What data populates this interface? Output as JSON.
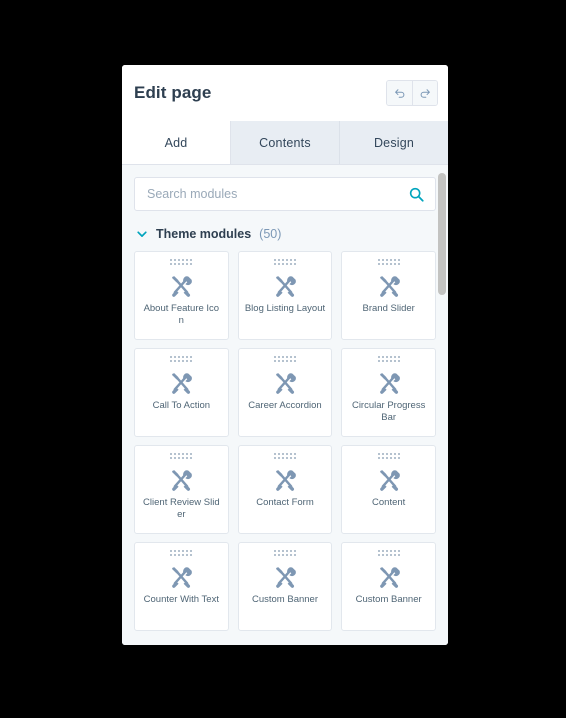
{
  "panel": {
    "title": "Edit page",
    "history": {
      "undo_label": "Undo",
      "undo_icon": "undo-arrow-icon",
      "redo_label": "Redo",
      "redo_icon": "redo-arrow-icon"
    },
    "tabs": [
      {
        "label": "Add",
        "active": true
      },
      {
        "label": "Contents",
        "active": false
      },
      {
        "label": "Design",
        "active": false
      }
    ]
  },
  "search": {
    "value": "",
    "placeholder": "Search modules",
    "icon": "search-icon",
    "icon_color": "#00a4bd"
  },
  "section": {
    "chevron_icon": "chevron-down-icon",
    "chevron_color": "#00a4bd",
    "title": "Theme modules",
    "count": "(50)",
    "expanded": true
  },
  "modules": [
    {
      "label": "About Feature Icon",
      "icon": "tools-icon"
    },
    {
      "label": "Blog Listing Layout",
      "icon": "tools-icon"
    },
    {
      "label": "Brand Slider",
      "icon": "tools-icon"
    },
    {
      "label": "Call To Action",
      "icon": "tools-icon"
    },
    {
      "label": "Career Accordion",
      "icon": "tools-icon"
    },
    {
      "label": "Circular Progress Bar",
      "icon": "tools-icon"
    },
    {
      "label": "Client Review Slider",
      "icon": "tools-icon"
    },
    {
      "label": "Contact Form",
      "icon": "tools-icon"
    },
    {
      "label": "Content",
      "icon": "tools-icon"
    },
    {
      "label": "Counter With Text",
      "icon": "tools-icon"
    },
    {
      "label": "Custom Banner",
      "icon": "tools-icon"
    },
    {
      "label": "Custom Banner",
      "icon": "tools-icon"
    }
  ],
  "colors": {
    "accent": "#00a4bd",
    "title_text": "#2e3f50",
    "body_text": "#33475b",
    "module_icon": "#7e97b3",
    "panel_bg": "#f5f8fa",
    "card_bg": "#ffffff",
    "backdrop": "#000000"
  },
  "scrollbar": {
    "thumb_color": "#c3c3c1",
    "orientation": "vertical"
  }
}
